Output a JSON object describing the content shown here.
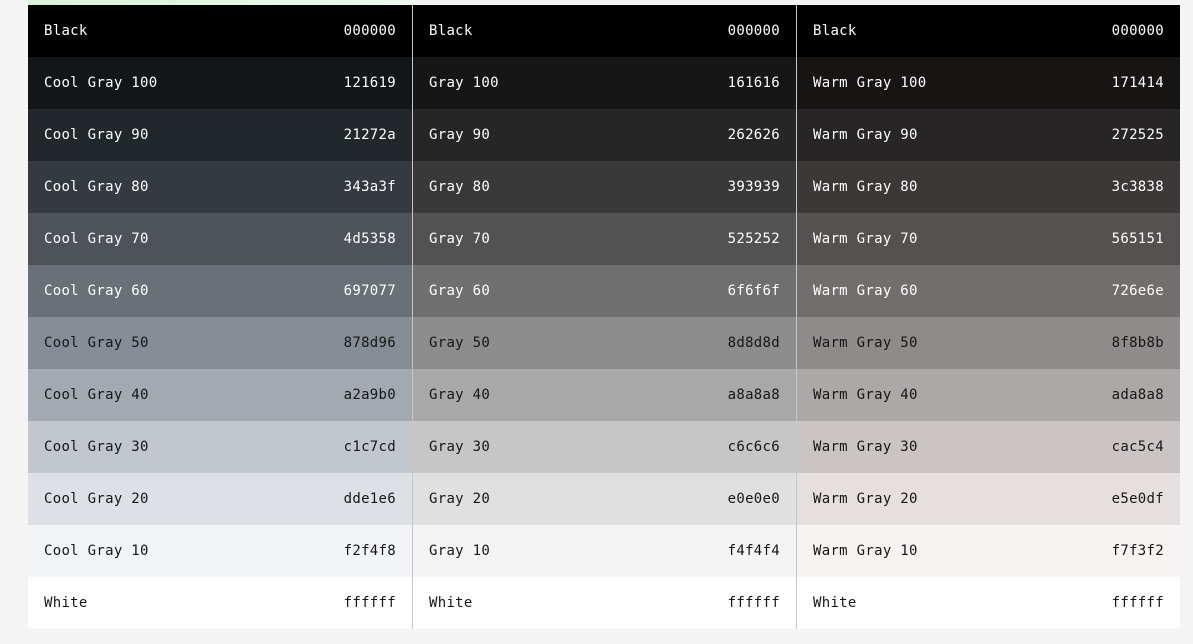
{
  "columns": [
    {
      "name": "cool-gray",
      "swatches": [
        {
          "name": "Black",
          "hex": "000000",
          "bg": "#000000",
          "fg": "#ffffff"
        },
        {
          "name": "Cool Gray 100",
          "hex": "121619",
          "bg": "#121619",
          "fg": "#ffffff"
        },
        {
          "name": "Cool Gray 90",
          "hex": "21272a",
          "bg": "#21272a",
          "fg": "#ffffff"
        },
        {
          "name": "Cool Gray 80",
          "hex": "343a3f",
          "bg": "#343a3f",
          "fg": "#ffffff"
        },
        {
          "name": "Cool Gray 70",
          "hex": "4d5358",
          "bg": "#4d5358",
          "fg": "#ffffff"
        },
        {
          "name": "Cool Gray 60",
          "hex": "697077",
          "bg": "#697077",
          "fg": "#ffffff"
        },
        {
          "name": "Cool Gray 50",
          "hex": "878d96",
          "bg": "#878d96",
          "fg": "#161616"
        },
        {
          "name": "Cool Gray 40",
          "hex": "a2a9b0",
          "bg": "#a2a9b0",
          "fg": "#161616"
        },
        {
          "name": "Cool Gray 30",
          "hex": "c1c7cd",
          "bg": "#c1c7cd",
          "fg": "#161616"
        },
        {
          "name": "Cool Gray 20",
          "hex": "dde1e6",
          "bg": "#dde1e6",
          "fg": "#161616"
        },
        {
          "name": "Cool Gray 10",
          "hex": "f2f4f8",
          "bg": "#f2f4f8",
          "fg": "#161616"
        },
        {
          "name": "White",
          "hex": "ffffff",
          "bg": "#ffffff",
          "fg": "#161616"
        }
      ]
    },
    {
      "name": "gray",
      "swatches": [
        {
          "name": "Black",
          "hex": "000000",
          "bg": "#000000",
          "fg": "#ffffff"
        },
        {
          "name": "Gray 100",
          "hex": "161616",
          "bg": "#161616",
          "fg": "#ffffff"
        },
        {
          "name": "Gray 90",
          "hex": "262626",
          "bg": "#262626",
          "fg": "#ffffff"
        },
        {
          "name": "Gray 80",
          "hex": "393939",
          "bg": "#393939",
          "fg": "#ffffff"
        },
        {
          "name": "Gray 70",
          "hex": "525252",
          "bg": "#525252",
          "fg": "#ffffff"
        },
        {
          "name": "Gray 60",
          "hex": "6f6f6f",
          "bg": "#6f6f6f",
          "fg": "#ffffff"
        },
        {
          "name": "Gray 50",
          "hex": "8d8d8d",
          "bg": "#8d8d8d",
          "fg": "#161616"
        },
        {
          "name": "Gray 40",
          "hex": "a8a8a8",
          "bg": "#a8a8a8",
          "fg": "#161616"
        },
        {
          "name": "Gray 30",
          "hex": "c6c6c6",
          "bg": "#c6c6c6",
          "fg": "#161616"
        },
        {
          "name": "Gray 20",
          "hex": "e0e0e0",
          "bg": "#e0e0e0",
          "fg": "#161616"
        },
        {
          "name": "Gray 10",
          "hex": "f4f4f4",
          "bg": "#f4f4f4",
          "fg": "#161616"
        },
        {
          "name": "White",
          "hex": "ffffff",
          "bg": "#ffffff",
          "fg": "#161616"
        }
      ]
    },
    {
      "name": "warm-gray",
      "swatches": [
        {
          "name": "Black",
          "hex": "000000",
          "bg": "#000000",
          "fg": "#ffffff"
        },
        {
          "name": "Warm Gray 100",
          "hex": "171414",
          "bg": "#171414",
          "fg": "#ffffff"
        },
        {
          "name": "Warm Gray 90",
          "hex": "272525",
          "bg": "#272525",
          "fg": "#ffffff"
        },
        {
          "name": "Warm Gray 80",
          "hex": "3c3838",
          "bg": "#3c3838",
          "fg": "#ffffff"
        },
        {
          "name": "Warm Gray 70",
          "hex": "565151",
          "bg": "#565151",
          "fg": "#ffffff"
        },
        {
          "name": "Warm Gray 60",
          "hex": "726e6e",
          "bg": "#726e6e",
          "fg": "#ffffff"
        },
        {
          "name": "Warm Gray 50",
          "hex": "8f8b8b",
          "bg": "#8f8b8b",
          "fg": "#161616"
        },
        {
          "name": "Warm Gray 40",
          "hex": "ada8a8",
          "bg": "#ada8a8",
          "fg": "#161616"
        },
        {
          "name": "Warm Gray 30",
          "hex": "cac5c4",
          "bg": "#cac5c4",
          "fg": "#161616"
        },
        {
          "name": "Warm Gray 20",
          "hex": "e5e0df",
          "bg": "#e5e0df",
          "fg": "#161616"
        },
        {
          "name": "Warm Gray 10",
          "hex": "f7f3f2",
          "bg": "#f7f3f2",
          "fg": "#161616"
        },
        {
          "name": "White",
          "hex": "ffffff",
          "bg": "#ffffff",
          "fg": "#161616"
        }
      ]
    }
  ]
}
